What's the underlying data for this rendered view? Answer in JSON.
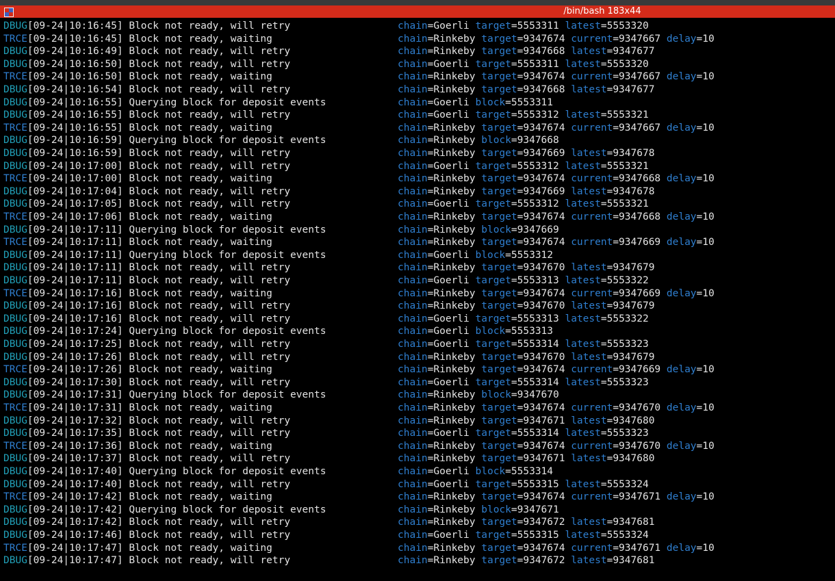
{
  "window": {
    "title": "/bin/bash 183x44"
  },
  "colors": {
    "titlebar": "#d42b1a",
    "background": "#000000",
    "text": "#e4e4e4",
    "level_debug": "#21a0b8",
    "level_trace": "#2f7fd0",
    "key": "#2f7fd0"
  },
  "icons": {
    "app": "terminal-app-icon"
  },
  "lines": [
    {
      "level": "DBUG",
      "time": "[09-24|10:16:45]",
      "message": "Block not ready, will retry",
      "fields": [
        {
          "k": "chain",
          "v": "Goerli"
        },
        {
          "k": "target",
          "v": "5553311"
        },
        {
          "k": "latest",
          "v": "5553320"
        }
      ]
    },
    {
      "level": "TRCE",
      "time": "[09-24|10:16:45]",
      "message": "Block not ready, waiting",
      "fields": [
        {
          "k": "chain",
          "v": "Rinkeby"
        },
        {
          "k": "target",
          "v": "9347674"
        },
        {
          "k": "current",
          "v": "9347667"
        },
        {
          "k": "delay",
          "v": "10"
        }
      ]
    },
    {
      "level": "DBUG",
      "time": "[09-24|10:16:49]",
      "message": "Block not ready, will retry",
      "fields": [
        {
          "k": "chain",
          "v": "Rinkeby"
        },
        {
          "k": "target",
          "v": "9347668"
        },
        {
          "k": "latest",
          "v": "9347677"
        }
      ]
    },
    {
      "level": "DBUG",
      "time": "[09-24|10:16:50]",
      "message": "Block not ready, will retry",
      "fields": [
        {
          "k": "chain",
          "v": "Goerli"
        },
        {
          "k": "target",
          "v": "5553311"
        },
        {
          "k": "latest",
          "v": "5553320"
        }
      ]
    },
    {
      "level": "TRCE",
      "time": "[09-24|10:16:50]",
      "message": "Block not ready, waiting",
      "fields": [
        {
          "k": "chain",
          "v": "Rinkeby"
        },
        {
          "k": "target",
          "v": "9347674"
        },
        {
          "k": "current",
          "v": "9347667"
        },
        {
          "k": "delay",
          "v": "10"
        }
      ]
    },
    {
      "level": "DBUG",
      "time": "[09-24|10:16:54]",
      "message": "Block not ready, will retry",
      "fields": [
        {
          "k": "chain",
          "v": "Rinkeby"
        },
        {
          "k": "target",
          "v": "9347668"
        },
        {
          "k": "latest",
          "v": "9347677"
        }
      ]
    },
    {
      "level": "DBUG",
      "time": "[09-24|10:16:55]",
      "message": "Querying block for deposit events",
      "fields": [
        {
          "k": "chain",
          "v": "Goerli"
        },
        {
          "k": "block",
          "v": "5553311"
        }
      ]
    },
    {
      "level": "DBUG",
      "time": "[09-24|10:16:55]",
      "message": "Block not ready, will retry",
      "fields": [
        {
          "k": "chain",
          "v": "Goerli"
        },
        {
          "k": "target",
          "v": "5553312"
        },
        {
          "k": "latest",
          "v": "5553321"
        }
      ]
    },
    {
      "level": "TRCE",
      "time": "[09-24|10:16:55]",
      "message": "Block not ready, waiting",
      "fields": [
        {
          "k": "chain",
          "v": "Rinkeby"
        },
        {
          "k": "target",
          "v": "9347674"
        },
        {
          "k": "current",
          "v": "9347667"
        },
        {
          "k": "delay",
          "v": "10"
        }
      ]
    },
    {
      "level": "DBUG",
      "time": "[09-24|10:16:59]",
      "message": "Querying block for deposit events",
      "fields": [
        {
          "k": "chain",
          "v": "Rinkeby"
        },
        {
          "k": "block",
          "v": "9347668"
        }
      ]
    },
    {
      "level": "DBUG",
      "time": "[09-24|10:16:59]",
      "message": "Block not ready, will retry",
      "fields": [
        {
          "k": "chain",
          "v": "Rinkeby"
        },
        {
          "k": "target",
          "v": "9347669"
        },
        {
          "k": "latest",
          "v": "9347678"
        }
      ]
    },
    {
      "level": "DBUG",
      "time": "[09-24|10:17:00]",
      "message": "Block not ready, will retry",
      "fields": [
        {
          "k": "chain",
          "v": "Goerli"
        },
        {
          "k": "target",
          "v": "5553312"
        },
        {
          "k": "latest",
          "v": "5553321"
        }
      ]
    },
    {
      "level": "TRCE",
      "time": "[09-24|10:17:00]",
      "message": "Block not ready, waiting",
      "fields": [
        {
          "k": "chain",
          "v": "Rinkeby"
        },
        {
          "k": "target",
          "v": "9347674"
        },
        {
          "k": "current",
          "v": "9347668"
        },
        {
          "k": "delay",
          "v": "10"
        }
      ]
    },
    {
      "level": "DBUG",
      "time": "[09-24|10:17:04]",
      "message": "Block not ready, will retry",
      "fields": [
        {
          "k": "chain",
          "v": "Rinkeby"
        },
        {
          "k": "target",
          "v": "9347669"
        },
        {
          "k": "latest",
          "v": "9347678"
        }
      ]
    },
    {
      "level": "DBUG",
      "time": "[09-24|10:17:05]",
      "message": "Block not ready, will retry",
      "fields": [
        {
          "k": "chain",
          "v": "Goerli"
        },
        {
          "k": "target",
          "v": "5553312"
        },
        {
          "k": "latest",
          "v": "5553321"
        }
      ]
    },
    {
      "level": "TRCE",
      "time": "[09-24|10:17:06]",
      "message": "Block not ready, waiting",
      "fields": [
        {
          "k": "chain",
          "v": "Rinkeby"
        },
        {
          "k": "target",
          "v": "9347674"
        },
        {
          "k": "current",
          "v": "9347668"
        },
        {
          "k": "delay",
          "v": "10"
        }
      ]
    },
    {
      "level": "DBUG",
      "time": "[09-24|10:17:11]",
      "message": "Querying block for deposit events",
      "fields": [
        {
          "k": "chain",
          "v": "Rinkeby"
        },
        {
          "k": "block",
          "v": "9347669"
        }
      ]
    },
    {
      "level": "TRCE",
      "time": "[09-24|10:17:11]",
      "message": "Block not ready, waiting",
      "fields": [
        {
          "k": "chain",
          "v": "Rinkeby"
        },
        {
          "k": "target",
          "v": "9347674"
        },
        {
          "k": "current",
          "v": "9347669"
        },
        {
          "k": "delay",
          "v": "10"
        }
      ]
    },
    {
      "level": "DBUG",
      "time": "[09-24|10:17:11]",
      "message": "Querying block for deposit events",
      "fields": [
        {
          "k": "chain",
          "v": "Goerli"
        },
        {
          "k": "block",
          "v": "5553312"
        }
      ]
    },
    {
      "level": "DBUG",
      "time": "[09-24|10:17:11]",
      "message": "Block not ready, will retry",
      "fields": [
        {
          "k": "chain",
          "v": "Rinkeby"
        },
        {
          "k": "target",
          "v": "9347670"
        },
        {
          "k": "latest",
          "v": "9347679"
        }
      ]
    },
    {
      "level": "DBUG",
      "time": "[09-24|10:17:11]",
      "message": "Block not ready, will retry",
      "fields": [
        {
          "k": "chain",
          "v": "Goerli"
        },
        {
          "k": "target",
          "v": "5553313"
        },
        {
          "k": "latest",
          "v": "5553322"
        }
      ]
    },
    {
      "level": "TRCE",
      "time": "[09-24|10:17:16]",
      "message": "Block not ready, waiting",
      "fields": [
        {
          "k": "chain",
          "v": "Rinkeby"
        },
        {
          "k": "target",
          "v": "9347674"
        },
        {
          "k": "current",
          "v": "9347669"
        },
        {
          "k": "delay",
          "v": "10"
        }
      ]
    },
    {
      "level": "DBUG",
      "time": "[09-24|10:17:16]",
      "message": "Block not ready, will retry",
      "fields": [
        {
          "k": "chain",
          "v": "Rinkeby"
        },
        {
          "k": "target",
          "v": "9347670"
        },
        {
          "k": "latest",
          "v": "9347679"
        }
      ]
    },
    {
      "level": "DBUG",
      "time": "[09-24|10:17:16]",
      "message": "Block not ready, will retry",
      "fields": [
        {
          "k": "chain",
          "v": "Goerli"
        },
        {
          "k": "target",
          "v": "5553313"
        },
        {
          "k": "latest",
          "v": "5553322"
        }
      ]
    },
    {
      "level": "DBUG",
      "time": "[09-24|10:17:24]",
      "message": "Querying block for deposit events",
      "fields": [
        {
          "k": "chain",
          "v": "Goerli"
        },
        {
          "k": "block",
          "v": "5553313"
        }
      ]
    },
    {
      "level": "DBUG",
      "time": "[09-24|10:17:25]",
      "message": "Block not ready, will retry",
      "fields": [
        {
          "k": "chain",
          "v": "Goerli"
        },
        {
          "k": "target",
          "v": "5553314"
        },
        {
          "k": "latest",
          "v": "5553323"
        }
      ]
    },
    {
      "level": "DBUG",
      "time": "[09-24|10:17:26]",
      "message": "Block not ready, will retry",
      "fields": [
        {
          "k": "chain",
          "v": "Rinkeby"
        },
        {
          "k": "target",
          "v": "9347670"
        },
        {
          "k": "latest",
          "v": "9347679"
        }
      ]
    },
    {
      "level": "TRCE",
      "time": "[09-24|10:17:26]",
      "message": "Block not ready, waiting",
      "fields": [
        {
          "k": "chain",
          "v": "Rinkeby"
        },
        {
          "k": "target",
          "v": "9347674"
        },
        {
          "k": "current",
          "v": "9347669"
        },
        {
          "k": "delay",
          "v": "10"
        }
      ]
    },
    {
      "level": "DBUG",
      "time": "[09-24|10:17:30]",
      "message": "Block not ready, will retry",
      "fields": [
        {
          "k": "chain",
          "v": "Goerli"
        },
        {
          "k": "target",
          "v": "5553314"
        },
        {
          "k": "latest",
          "v": "5553323"
        }
      ]
    },
    {
      "level": "DBUG",
      "time": "[09-24|10:17:31]",
      "message": "Querying block for deposit events",
      "fields": [
        {
          "k": "chain",
          "v": "Rinkeby"
        },
        {
          "k": "block",
          "v": "9347670"
        }
      ]
    },
    {
      "level": "TRCE",
      "time": "[09-24|10:17:31]",
      "message": "Block not ready, waiting",
      "fields": [
        {
          "k": "chain",
          "v": "Rinkeby"
        },
        {
          "k": "target",
          "v": "9347674"
        },
        {
          "k": "current",
          "v": "9347670"
        },
        {
          "k": "delay",
          "v": "10"
        }
      ]
    },
    {
      "level": "DBUG",
      "time": "[09-24|10:17:32]",
      "message": "Block not ready, will retry",
      "fields": [
        {
          "k": "chain",
          "v": "Rinkeby"
        },
        {
          "k": "target",
          "v": "9347671"
        },
        {
          "k": "latest",
          "v": "9347680"
        }
      ]
    },
    {
      "level": "DBUG",
      "time": "[09-24|10:17:35]",
      "message": "Block not ready, will retry",
      "fields": [
        {
          "k": "chain",
          "v": "Goerli"
        },
        {
          "k": "target",
          "v": "5553314"
        },
        {
          "k": "latest",
          "v": "5553323"
        }
      ]
    },
    {
      "level": "TRCE",
      "time": "[09-24|10:17:36]",
      "message": "Block not ready, waiting",
      "fields": [
        {
          "k": "chain",
          "v": "Rinkeby"
        },
        {
          "k": "target",
          "v": "9347674"
        },
        {
          "k": "current",
          "v": "9347670"
        },
        {
          "k": "delay",
          "v": "10"
        }
      ]
    },
    {
      "level": "DBUG",
      "time": "[09-24|10:17:37]",
      "message": "Block not ready, will retry",
      "fields": [
        {
          "k": "chain",
          "v": "Rinkeby"
        },
        {
          "k": "target",
          "v": "9347671"
        },
        {
          "k": "latest",
          "v": "9347680"
        }
      ]
    },
    {
      "level": "DBUG",
      "time": "[09-24|10:17:40]",
      "message": "Querying block for deposit events",
      "fields": [
        {
          "k": "chain",
          "v": "Goerli"
        },
        {
          "k": "block",
          "v": "5553314"
        }
      ]
    },
    {
      "level": "DBUG",
      "time": "[09-24|10:17:40]",
      "message": "Block not ready, will retry",
      "fields": [
        {
          "k": "chain",
          "v": "Goerli"
        },
        {
          "k": "target",
          "v": "5553315"
        },
        {
          "k": "latest",
          "v": "5553324"
        }
      ]
    },
    {
      "level": "TRCE",
      "time": "[09-24|10:17:42]",
      "message": "Block not ready, waiting",
      "fields": [
        {
          "k": "chain",
          "v": "Rinkeby"
        },
        {
          "k": "target",
          "v": "9347674"
        },
        {
          "k": "current",
          "v": "9347671"
        },
        {
          "k": "delay",
          "v": "10"
        }
      ]
    },
    {
      "level": "DBUG",
      "time": "[09-24|10:17:42]",
      "message": "Querying block for deposit events",
      "fields": [
        {
          "k": "chain",
          "v": "Rinkeby"
        },
        {
          "k": "block",
          "v": "9347671"
        }
      ]
    },
    {
      "level": "DBUG",
      "time": "[09-24|10:17:42]",
      "message": "Block not ready, will retry",
      "fields": [
        {
          "k": "chain",
          "v": "Rinkeby"
        },
        {
          "k": "target",
          "v": "9347672"
        },
        {
          "k": "latest",
          "v": "9347681"
        }
      ]
    },
    {
      "level": "DBUG",
      "time": "[09-24|10:17:46]",
      "message": "Block not ready, will retry",
      "fields": [
        {
          "k": "chain",
          "v": "Goerli"
        },
        {
          "k": "target",
          "v": "5553315"
        },
        {
          "k": "latest",
          "v": "5553324"
        }
      ]
    },
    {
      "level": "TRCE",
      "time": "[09-24|10:17:47]",
      "message": "Block not ready, waiting",
      "fields": [
        {
          "k": "chain",
          "v": "Rinkeby"
        },
        {
          "k": "target",
          "v": "9347674"
        },
        {
          "k": "current",
          "v": "9347671"
        },
        {
          "k": "delay",
          "v": "10"
        }
      ]
    },
    {
      "level": "DBUG",
      "time": "[09-24|10:17:47]",
      "message": "Block not ready, will retry",
      "fields": [
        {
          "k": "chain",
          "v": "Rinkeby"
        },
        {
          "k": "target",
          "v": "9347672"
        },
        {
          "k": "latest",
          "v": "9347681"
        }
      ]
    }
  ]
}
